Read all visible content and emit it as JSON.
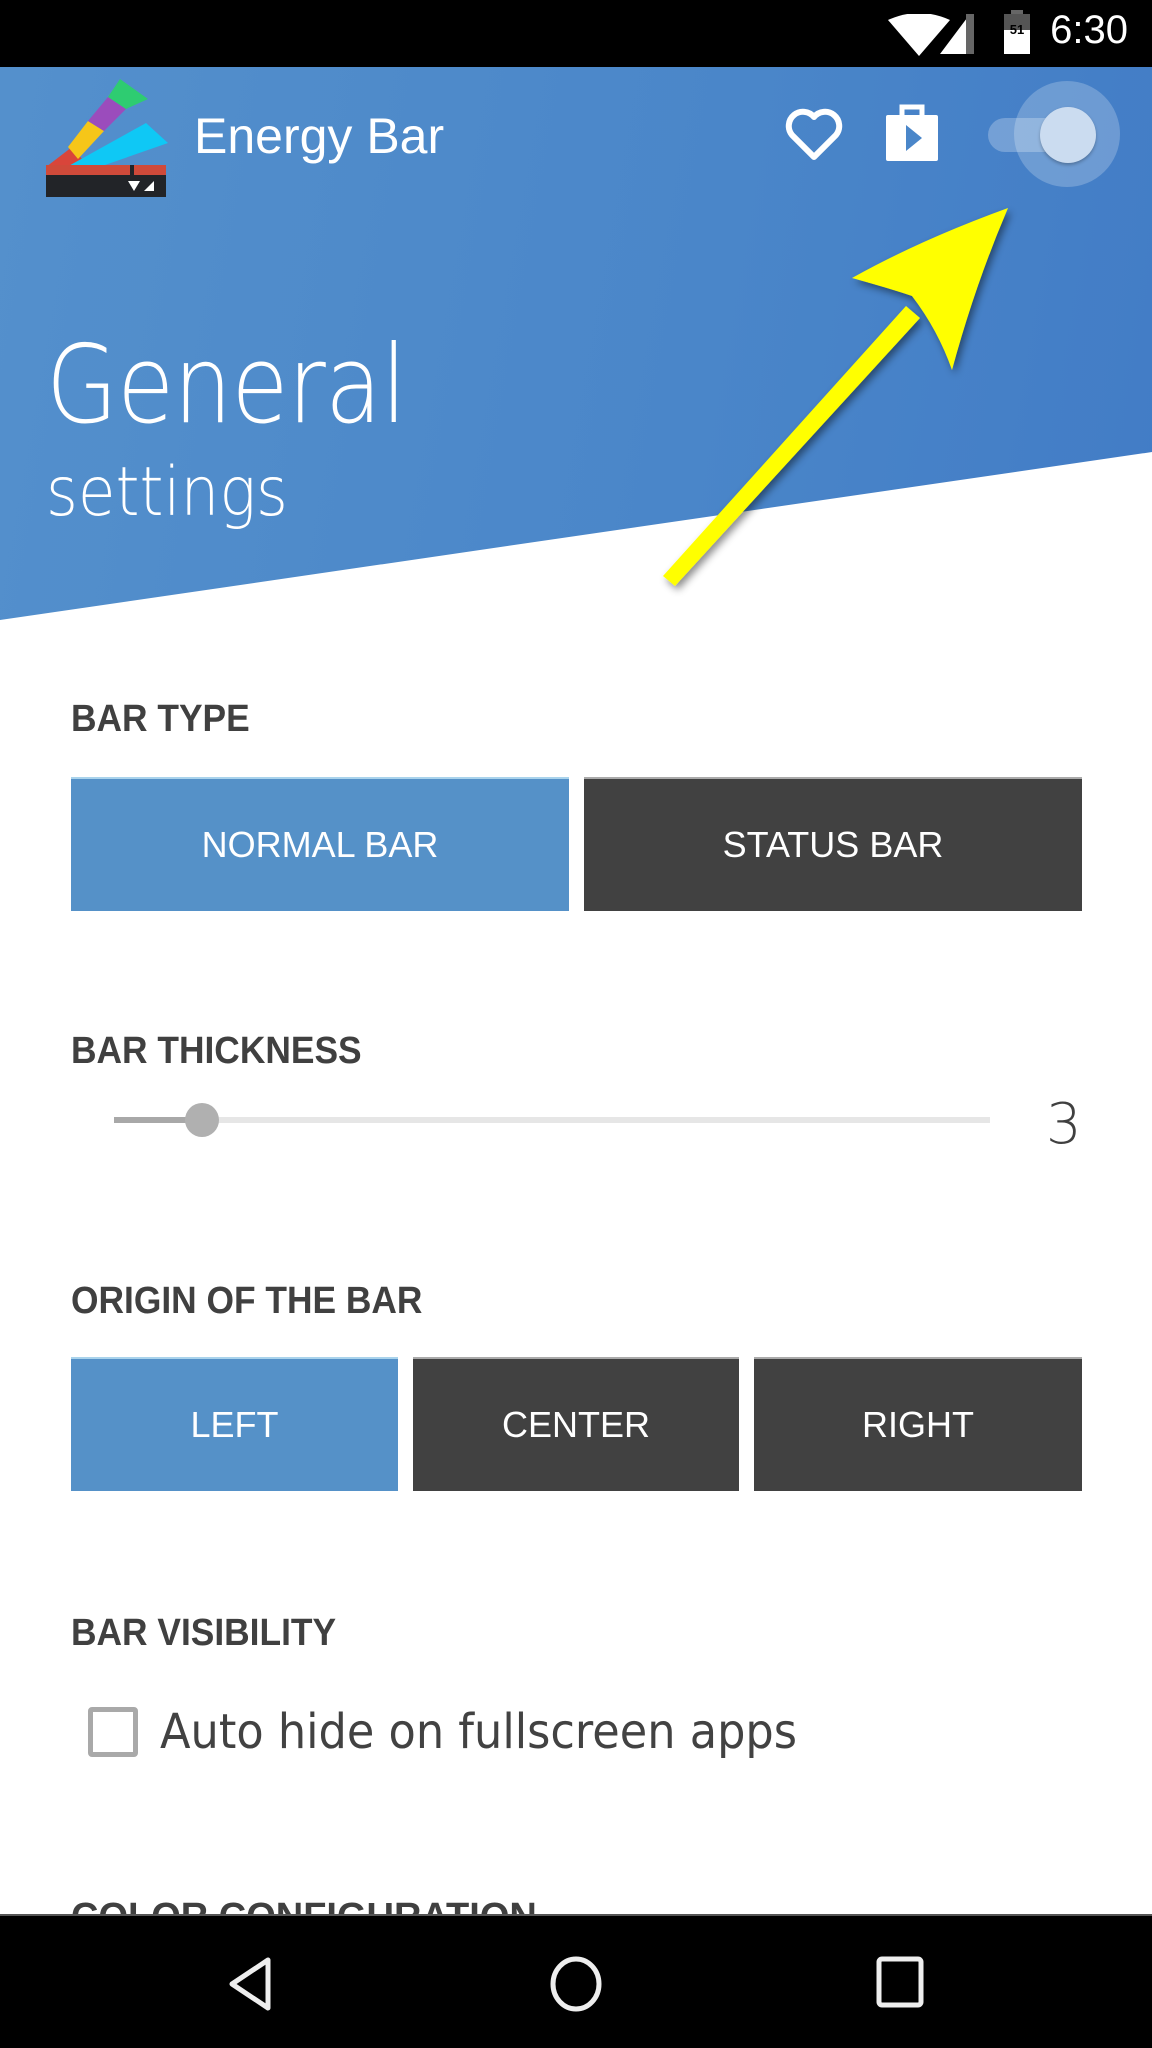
{
  "status_bar": {
    "time": "6:30",
    "battery_level": "51",
    "icons": [
      "wifi-icon",
      "signal-icon",
      "battery-icon"
    ]
  },
  "header": {
    "app_title": "Energy Bar",
    "title": "General",
    "subtitle": "settings",
    "actions": [
      {
        "name": "favorite",
        "icon": "heart-icon"
      },
      {
        "name": "play-store",
        "icon": "play-store-icon"
      }
    ],
    "master_toggle": {
      "state": "on"
    },
    "colors": {
      "header_blue": "#4a86c9"
    }
  },
  "annotation": {
    "type": "arrow",
    "color": "#ffff00",
    "target": "master-toggle"
  },
  "sections": {
    "bar_type": {
      "title": "BAR TYPE",
      "options": [
        {
          "label": "NORMAL BAR",
          "selected": true
        },
        {
          "label": "STATUS BAR",
          "selected": false
        }
      ]
    },
    "bar_thickness": {
      "title": "BAR THICKNESS",
      "value": "3",
      "min": 1,
      "max": 20,
      "fraction": 0.1
    },
    "origin": {
      "title": "ORIGIN OF THE BAR",
      "options": [
        {
          "label": "LEFT",
          "selected": true
        },
        {
          "label": "CENTER",
          "selected": false
        },
        {
          "label": "RIGHT",
          "selected": false
        }
      ]
    },
    "visibility": {
      "title": "BAR VISIBILITY",
      "checkbox_label": "Auto hide on fullscreen apps",
      "checked": false
    },
    "color_config": {
      "title": "COLOR CONFIGURATION"
    }
  },
  "colors": {
    "selected": "#5591c8",
    "unselected": "#414141",
    "text_dark": "#404040"
  },
  "nav_bar": {
    "buttons": [
      "back-icon",
      "home-icon",
      "recents-icon"
    ]
  }
}
